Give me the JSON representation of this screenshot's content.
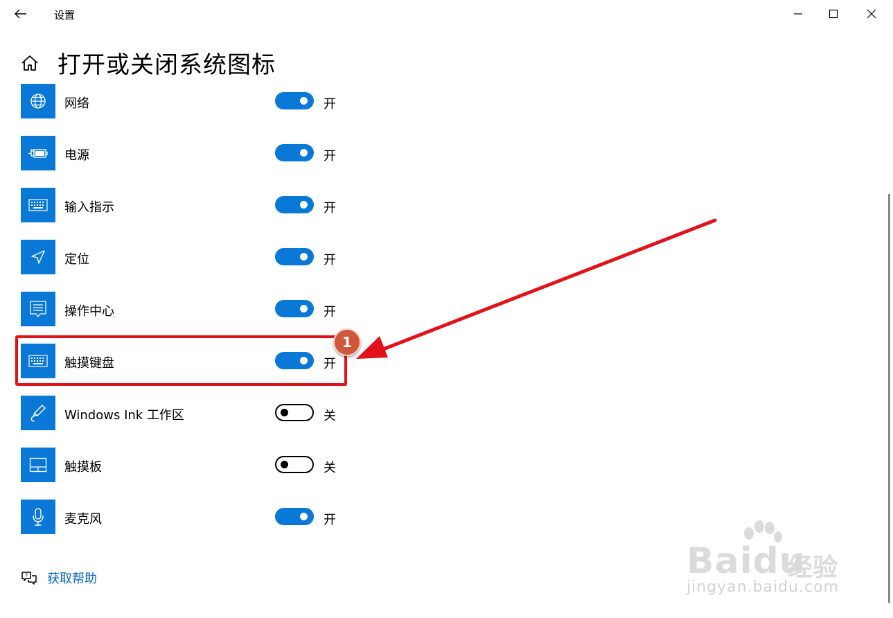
{
  "window": {
    "title": "设置",
    "back_icon": "arrow-left-icon",
    "controls": [
      "minimize-icon",
      "maximize-icon",
      "close-icon"
    ]
  },
  "page": {
    "home_icon": "home-icon",
    "title": "打开或关闭系统图标"
  },
  "items": [
    {
      "label": "网络",
      "icon": "globe-icon",
      "on": true,
      "state": "开"
    },
    {
      "label": "电源",
      "icon": "battery-plug-icon",
      "on": true,
      "state": "开"
    },
    {
      "label": "输入指示",
      "icon": "keyboard-icon",
      "on": true,
      "state": "开"
    },
    {
      "label": "定位",
      "icon": "location-arrow-icon",
      "on": true,
      "state": "开"
    },
    {
      "label": "操作中心",
      "icon": "action-center-icon",
      "on": true,
      "state": "开"
    },
    {
      "label": "触摸键盘",
      "icon": "keyboard-icon",
      "on": true,
      "state": "开"
    },
    {
      "label": "Windows Ink 工作区",
      "icon": "pen-icon",
      "on": false,
      "state": "关"
    },
    {
      "label": "触摸板",
      "icon": "touchpad-icon",
      "on": false,
      "state": "关"
    },
    {
      "label": "麦克风",
      "icon": "microphone-icon",
      "on": true,
      "state": "开"
    }
  ],
  "help": {
    "icon": "help-chat-icon",
    "label": "获取帮助"
  },
  "annotation": {
    "badge_number": "1",
    "color": "#e1121a"
  },
  "watermark": {
    "brand": "Baidu",
    "sub": "经验",
    "url": "jingyan.baidu.com"
  },
  "colors": {
    "accent": "#0a78d7",
    "link": "#0a66c2"
  }
}
